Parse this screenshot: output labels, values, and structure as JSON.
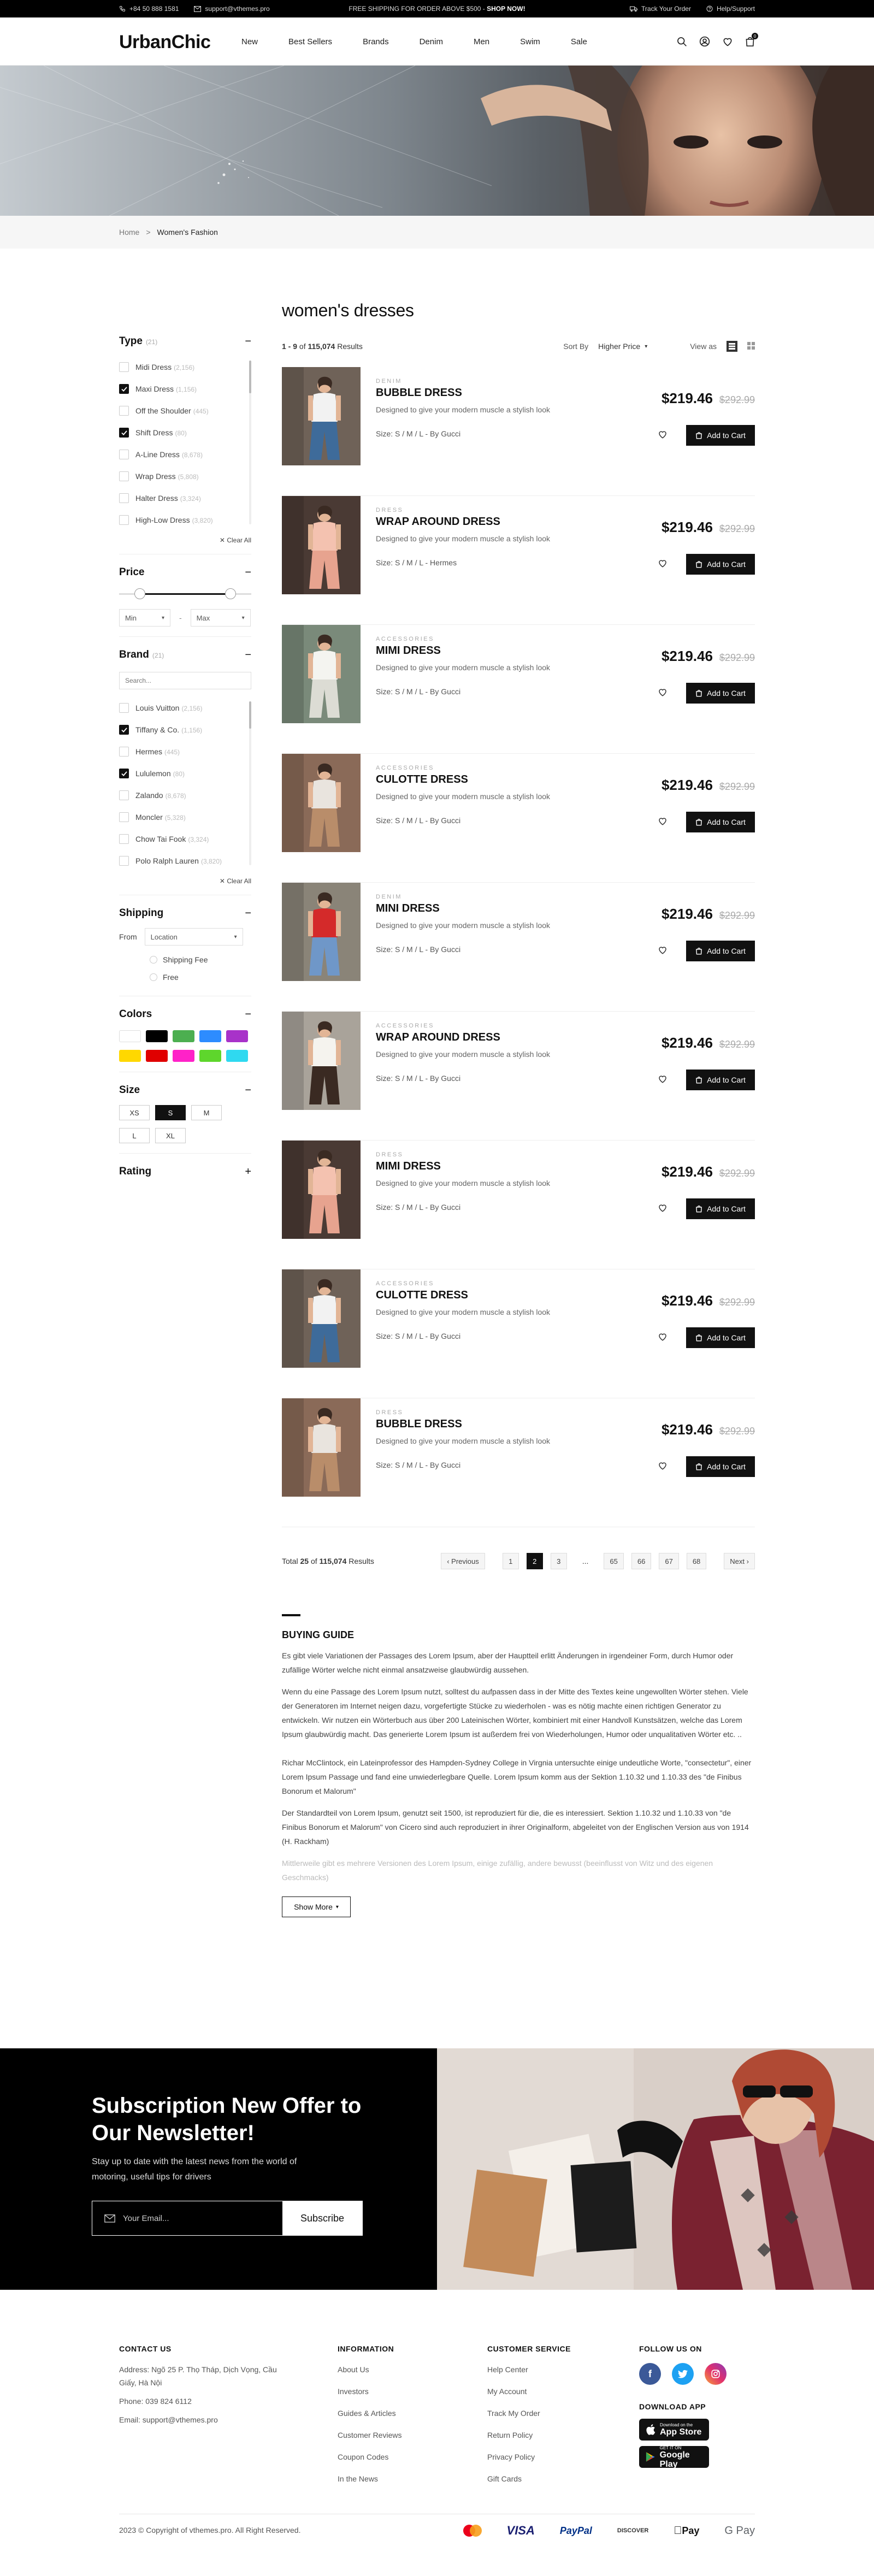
{
  "topbar": {
    "phone": "+84 50 888 1581",
    "email": "support@vthemes.pro",
    "promo_prefix": "FREE SHIPPING FOR ORDER ABOVE $500 - ",
    "promo_link": "SHOP NOW!",
    "track": "Track Your Order",
    "help": "Help/Support"
  },
  "header": {
    "logo": "UrbanChic",
    "nav": [
      "New",
      "Best Sellers",
      "Brands",
      "Denim",
      "Men",
      "Swim",
      "Sale"
    ],
    "cart_count": "0"
  },
  "breadcrumb": {
    "home": "Home",
    "separator": ">",
    "current": "Women's Fashion"
  },
  "filters": {
    "type": {
      "title": "Type",
      "count": "(21)",
      "items": [
        {
          "label": "Midi Dress",
          "count": "(2,156)",
          "checked": false
        },
        {
          "label": "Maxi Dress",
          "count": "(1,156)",
          "checked": true
        },
        {
          "label": "Off the Shoulder",
          "count": "(445)",
          "checked": false
        },
        {
          "label": "Shift Dress",
          "count": "(80)",
          "checked": true
        },
        {
          "label": "A-Line Dress",
          "count": "(8,678)",
          "checked": false
        },
        {
          "label": "Wrap Dress",
          "count": "(5,808)",
          "checked": false
        },
        {
          "label": "Halter Dress",
          "count": "(3,324)",
          "checked": false
        },
        {
          "label": "High-Low Dress",
          "count": "(3,820)",
          "checked": false
        }
      ],
      "clear": "Clear All"
    },
    "price": {
      "title": "Price",
      "min_label": "Min",
      "max_label": "Max",
      "dash": "-"
    },
    "brand": {
      "title": "Brand",
      "count": "(21)",
      "search_placeholder": "Search...",
      "items": [
        {
          "label": "Louis Vuitton",
          "count": "(2,156)",
          "checked": false
        },
        {
          "label": "Tiffany & Co.",
          "count": "(1,156)",
          "checked": true
        },
        {
          "label": "Hermes",
          "count": "(445)",
          "checked": false
        },
        {
          "label": "Lululemon",
          "count": "(80)",
          "checked": true
        },
        {
          "label": "Zalando",
          "count": "(8,678)",
          "checked": false
        },
        {
          "label": "Moncler",
          "count": "(5,328)",
          "checked": false
        },
        {
          "label": "Chow Tai Fook",
          "count": "(3,324)",
          "checked": false
        },
        {
          "label": "Polo Ralph Lauren",
          "count": "(3,820)",
          "checked": false
        }
      ],
      "clear": "Clear All"
    },
    "shipping": {
      "title": "Shipping",
      "from_label": "From",
      "from_value": "Location",
      "options": [
        "Shipping Fee",
        "Free"
      ]
    },
    "colors": {
      "title": "Colors",
      "swatches": [
        "#ffffff",
        "#000000",
        "#4caf50",
        "#2d8cff",
        "#a832c9",
        "#ffd800",
        "#e00000",
        "#ff22c8",
        "#5ed62c",
        "#2fd9f0"
      ]
    },
    "size": {
      "title": "Size",
      "options": [
        "XS",
        "S",
        "M",
        "L",
        "XL"
      ],
      "selected": "S"
    },
    "rating": {
      "title": "Rating"
    }
  },
  "main": {
    "title": "women's dresses",
    "results_range": "1 - 9",
    "results_of": "of",
    "results_total": "115,074",
    "results_word": "Results",
    "sort_label": "Sort By",
    "sort_value": "Higher Price",
    "view_label": "View as"
  },
  "products": [
    {
      "category": "DENIM",
      "name": "BUBBLE DRESS",
      "desc": "Designed to give your modern muscle a stylish look",
      "size": "Size: S / M / L - By Gucci",
      "price": "$219.46",
      "old_price": "$292.99",
      "cta": "Add to Cart"
    },
    {
      "category": "DRESS",
      "name": "WRAP AROUND DRESS",
      "desc": "Designed to give your modern muscle a stylish look",
      "size": "Size: S / M / L - Hermes",
      "price": "$219.46",
      "old_price": "$292.99",
      "cta": "Add to Cart"
    },
    {
      "category": "ACCESSORIES",
      "name": "MIMI DRESS",
      "desc": "Designed to give your modern muscle a stylish look",
      "size": "Size: S / M / L - By Gucci",
      "price": "$219.46",
      "old_price": "$292.99",
      "cta": "Add to Cart"
    },
    {
      "category": "ACCESSORIES",
      "name": "CULOTTE DRESS",
      "desc": "Designed to give your modern muscle a stylish look",
      "size": "Size: S / M / L - By Gucci",
      "price": "$219.46",
      "old_price": "$292.99",
      "cta": "Add to Cart"
    },
    {
      "category": "DENIM",
      "name": "MINI DRESS",
      "desc": "Designed to give your modern muscle a stylish look",
      "size": "Size: S / M / L - By Gucci",
      "price": "$219.46",
      "old_price": "$292.99",
      "cta": "Add to Cart"
    },
    {
      "category": "ACCESSORIES",
      "name": "WRAP AROUND DRESS",
      "desc": "Designed to give your modern muscle a stylish look",
      "size": "Size: S / M / L - By Gucci",
      "price": "$219.46",
      "old_price": "$292.99",
      "cta": "Add to Cart"
    },
    {
      "category": "DRESS",
      "name": "MIMI DRESS",
      "desc": "Designed to give your modern muscle a stylish look",
      "size": "Size: S / M / L - By Gucci",
      "price": "$219.46",
      "old_price": "$292.99",
      "cta": "Add to Cart"
    },
    {
      "category": "ACCESSORIES",
      "name": "CULOTTE DRESS",
      "desc": "Designed to give your modern muscle a stylish look",
      "size": "Size: S / M / L - By Gucci",
      "price": "$219.46",
      "old_price": "$292.99",
      "cta": "Add to Cart"
    },
    {
      "category": "DRESS",
      "name": "BUBBLE DRESS",
      "desc": "Designed to give your modern muscle a stylish look",
      "size": "Size: S / M / L - By Gucci",
      "price": "$219.46",
      "old_price": "$292.99",
      "cta": "Add to Cart"
    }
  ],
  "pagination": {
    "total_prefix": "Total",
    "shown": "25",
    "of": "of",
    "total": "115,074",
    "results": "Results",
    "prev": "Previous",
    "next": "Next",
    "pages": [
      "1",
      "2",
      "3",
      "...",
      "65",
      "66",
      "67",
      "68"
    ],
    "current": "2"
  },
  "guide": {
    "title": "BUYING GUIDE",
    "p1": "Es gibt viele Variationen der Passages des Lorem Ipsum, aber der Hauptteil erlitt Änderungen in irgendeiner Form, durch Humor oder zufällige Wörter welche nicht einmal ansatzweise glaubwürdig aussehen.",
    "p2": "Wenn du eine Passage des Lorem Ipsum nutzt, solltest du aufpassen dass in der Mitte des Textes keine ungewollten Wörter stehen. Viele der Generatoren im Internet neigen dazu, vorgefertigte Stücke zu wiederholen - was es nötig machte einen richtigen Generator zu entwickeln. Wir nutzen ein Wörterbuch aus über 200 Lateinischen Wörter, kombiniert mit einer Handvoll Kunstsätzen, welche das Lorem Ipsum glaubwürdig macht. Das generierte Lorem Ipsum ist außerdem frei von Wiederholungen, Humor oder unqualitativen Wörter etc. ..",
    "p3": "Richar McClintock, ein Lateinprofessor des Hampden-Sydney College in Virgnia untersuchte einige undeutliche Worte, \"consectetur\", einer Lorem Ipsum Passage und fand eine unwiederlegbare Quelle. Lorem Ipsum komm aus der Sektion 1.10.32 und 1.10.33 des \"de Finibus Bonorum et Malorum\"",
    "p4": "Der Standardteil von Lorem Ipsum, genutzt seit 1500, ist reproduziert für die, die es interessiert. Sektion 1.10.32 und 1.10.33 von \"de Finibus Bonorum et Malorum\" von Cicero sind auch reproduziert in ihrer Originalform, abgeleitet von der Englischen Version aus von 1914 (H. Rackham)",
    "p5": "Mittlerweile gibt es mehrere Versionen des Lorem Ipsum, einige zufällig, andere bewusst (beeinflusst von Witz und des eigenen Geschmacks)",
    "show_more": "Show More"
  },
  "newsletter": {
    "title": "Subscription New Offer to Our Newsletter!",
    "text": "Stay up to date with the latest news from the world of motoring, useful tips for drivers",
    "placeholder": "Your Email...",
    "button": "Subscribe"
  },
  "footer": {
    "contact_title": "CONTACT US",
    "address": "Address: Ngõ 25 P. Thọ Tháp, Dịch Vọng, Cầu Giấy, Hà Nội",
    "phone": "Phone: 039 824 6112",
    "email": "Email: support@vthemes.pro",
    "info_title": "INFORMATION",
    "info_links": [
      "About Us",
      "Investors",
      "Guides & Articles",
      "Customer Reviews",
      "Coupon Codes",
      "In the News"
    ],
    "service_title": "CUSTOMER SERVICE",
    "service_links": [
      "Help Center",
      "My Account",
      "Track My Order",
      "Return Policy",
      "Privacy Policy",
      "Gift Cards"
    ],
    "follow_title": "FOLLOW US ON",
    "social": [
      "facebook-icon",
      "twitter-icon",
      "instagram-icon"
    ],
    "app_title": "DOWNLOAD APP",
    "appstore_small": "Download on the",
    "appstore_big": "App Store",
    "gplay_small": "GET IT ON",
    "gplay_big": "Google Play",
    "copyright": "2023 © Copyright of vthemes.pro. All Right Reserved.",
    "payments": [
      "mastercard-icon",
      "VISA",
      "PayPal",
      "DISCOVER",
      "Pay",
      "G Pay"
    ]
  },
  "colors": {
    "accent": "#111111",
    "muted": "#aaaaaa",
    "topbar": "#000000"
  }
}
